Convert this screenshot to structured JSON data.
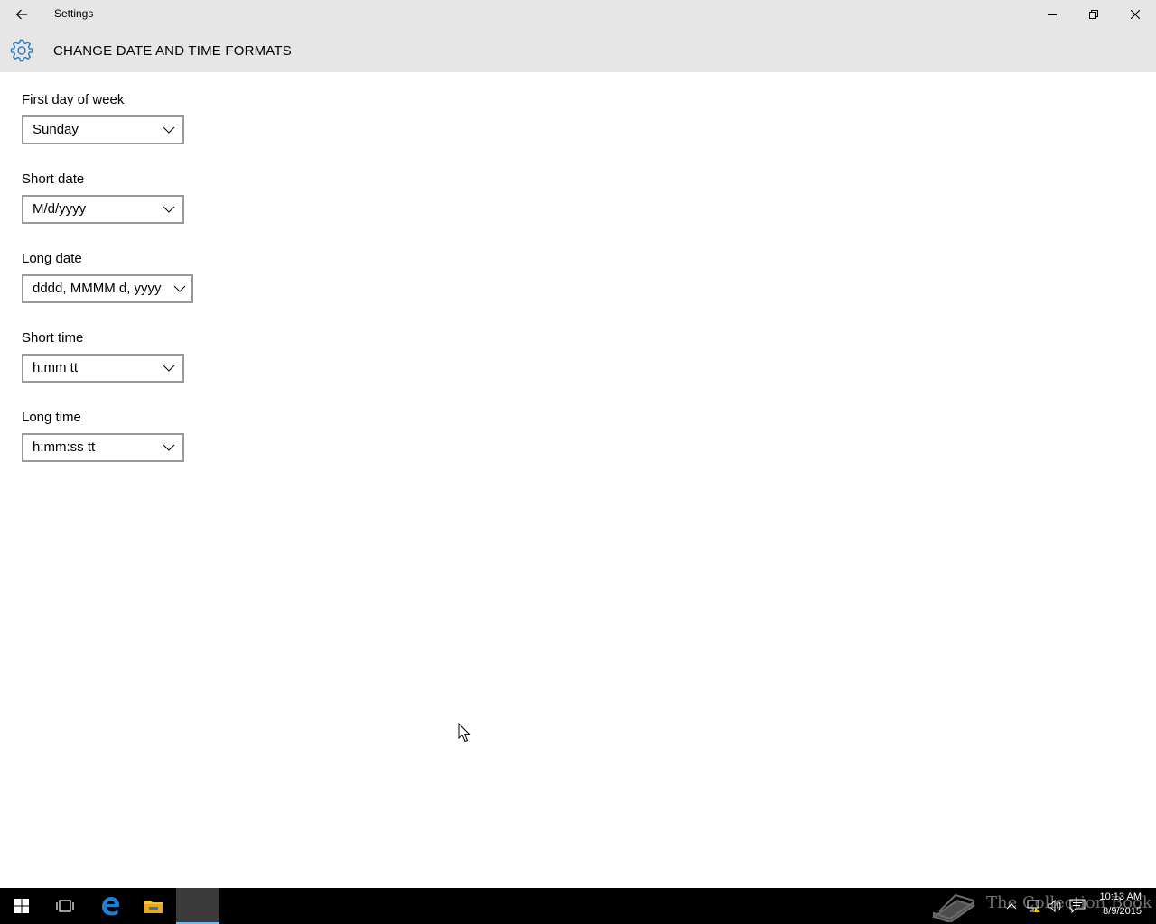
{
  "window": {
    "app_title": "Settings"
  },
  "header": {
    "page_title": "CHANGE DATE AND TIME FORMATS",
    "icon": "gear-icon"
  },
  "fields": [
    {
      "label": "First day of week",
      "value": "Sunday"
    },
    {
      "label": "Short date",
      "value": "M/d/yyyy"
    },
    {
      "label": "Long date",
      "value": "dddd, MMMM d, yyyy"
    },
    {
      "label": "Short time",
      "value": "h:mm tt"
    },
    {
      "label": "Long time",
      "value": "h:mm:ss tt"
    }
  ],
  "taskbar": {
    "watermark": "The Collection Book",
    "clock_time": "10:13 AM",
    "clock_date": "8/9/2015"
  },
  "colors": {
    "titlebar_bg": "#e6e6e6",
    "accent": "#2a7bc4",
    "taskbar_bg": "#000000"
  }
}
